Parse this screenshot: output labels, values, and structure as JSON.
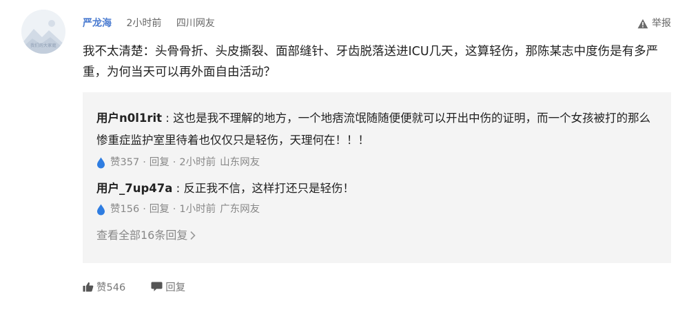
{
  "comment": {
    "avatar_text": "我们的大家庭",
    "username": "严龙海",
    "time": "2小时前",
    "location": "四川网友",
    "report_label": "举报",
    "body": "我不太清楚：头骨骨折、头皮撕裂、面部缝针、牙齿脱落送进ICU几天，这算轻伤，那陈某志中度伤是有多严重，为何当天可以再外面自由活动？",
    "like_label": "赞546",
    "reply_label": "回复"
  },
  "replies": [
    {
      "user": "用户n0l1rit",
      "separator": " : ",
      "text": "这也是我不理解的地方，一个地痞流氓随随便便就可以开出中伤的证明，而一个女孩被打的那么惨重症监护室里待着也仅仅只是轻伤，天理何在！！！",
      "likes": "赞357",
      "reply": "回复",
      "time": "2小时前",
      "location": "山东网友"
    },
    {
      "user": "用户_7up47a",
      "separator": " : ",
      "text": "反正我不信，这样打还只是轻伤！",
      "likes": "赞156",
      "reply": "回复",
      "time": "1小时前",
      "location": "广东网友"
    }
  ],
  "view_all_label": "查看全部16条回复",
  "colors": {
    "username": "#4a7bd0",
    "like_drop": "#2f7de1",
    "reply_bg": "#f4f4f4",
    "meta": "#888888"
  }
}
